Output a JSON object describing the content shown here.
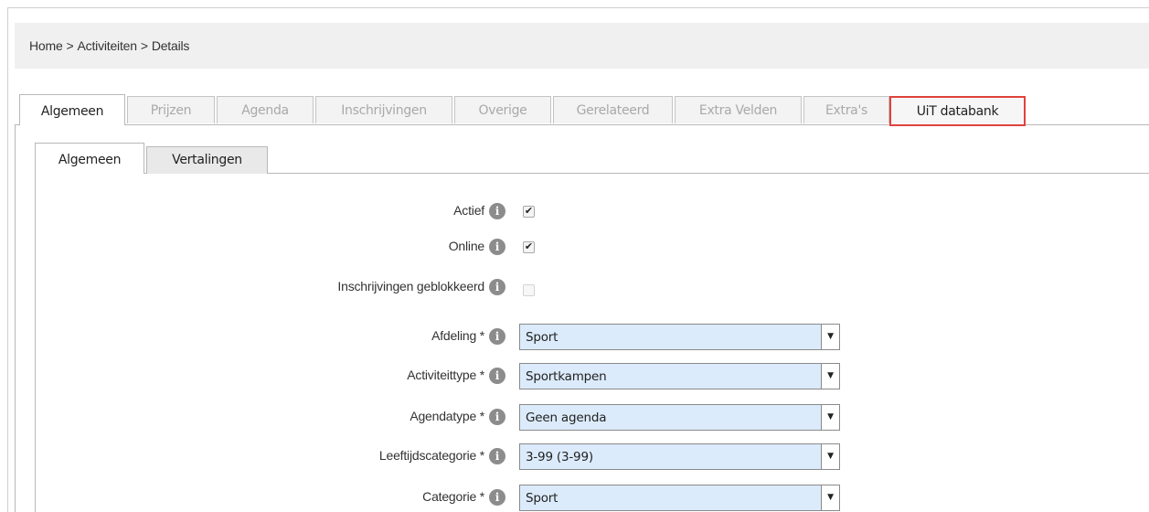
{
  "breadcrumb": {
    "home": "Home",
    "section": "Activiteiten",
    "page": "Details",
    "separator": ">"
  },
  "main_tabs": [
    {
      "label": "Algemeen",
      "state": "active"
    },
    {
      "label": "Prijzen",
      "state": "inactive"
    },
    {
      "label": "Agenda",
      "state": "inactive"
    },
    {
      "label": "Inschrijvingen",
      "state": "inactive"
    },
    {
      "label": "Overige",
      "state": "inactive"
    },
    {
      "label": "Gerelateerd",
      "state": "inactive"
    },
    {
      "label": "Extra Velden",
      "state": "inactive"
    },
    {
      "label": "Extra's",
      "state": "inactive"
    },
    {
      "label": "UiT databank",
      "state": "highlighted"
    }
  ],
  "sub_tabs": [
    {
      "label": "Algemeen",
      "state": "active"
    },
    {
      "label": "Vertalingen",
      "state": "inactive"
    }
  ],
  "form": {
    "actief": {
      "label": "Actief",
      "checked": true,
      "check_glyph": "✔"
    },
    "online": {
      "label": "Online",
      "checked": true,
      "check_glyph": "✔"
    },
    "inschrijvingen_geblokkeerd": {
      "label": "Inschrijvingen geblokkeerd",
      "checked": false
    },
    "afdeling": {
      "label": "Afdeling *",
      "value": "Sport"
    },
    "activiteittype": {
      "label": "Activiteittype *",
      "value": "Sportkampen"
    },
    "agendatype": {
      "label": "Agendatype *",
      "value": "Geen agenda"
    },
    "leeftijdscategorie": {
      "label": "Leeftijdscategorie *",
      "value": "3-99 (3-99)"
    },
    "categorie": {
      "label": "Categorie *",
      "value": "Sport"
    }
  },
  "icons": {
    "info": "info-icon",
    "dropdown": "chevron-down-icon",
    "check": "checkmark-icon"
  },
  "colors": {
    "highlight_border": "#e0423c",
    "select_bg": "#dcebfb",
    "info_icon": "#8c8c8c"
  }
}
